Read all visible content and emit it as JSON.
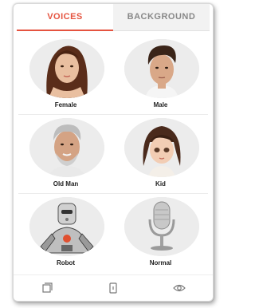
{
  "tabs": [
    {
      "label": "VOICES",
      "active": true
    },
    {
      "label": "BACKGROUND",
      "active": false
    }
  ],
  "voices": [
    {
      "label": "Female",
      "icon": "female-avatar"
    },
    {
      "label": "Male",
      "icon": "male-avatar"
    },
    {
      "label": "Old Man",
      "icon": "old-man-avatar"
    },
    {
      "label": "Kid",
      "icon": "kid-avatar"
    },
    {
      "label": "Robot",
      "icon": "robot-avatar"
    },
    {
      "label": "Normal",
      "icon": "microphone-avatar"
    }
  ],
  "bottom_nav": [
    {
      "icon": "projects-icon"
    },
    {
      "icon": "device-icon"
    },
    {
      "icon": "eye-icon"
    }
  ],
  "colors": {
    "accent": "#e5533f"
  }
}
